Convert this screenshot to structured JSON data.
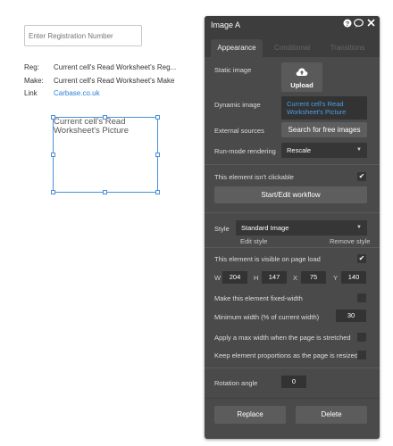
{
  "canvas": {
    "reg_placeholder": "Enter Registration Number",
    "rows": [
      {
        "key": "Reg:",
        "value": "Current cell's Read Worksheet's Reg..."
      },
      {
        "key": "Make:",
        "value": "Current cell's Read Worksheet's Make"
      },
      {
        "key": "Link",
        "value": "Carbase.co.uk"
      }
    ],
    "image_text": "Current cell's Read Worksheet's Picture"
  },
  "panel": {
    "title": "Image A",
    "tabs": [
      "Appearance",
      "Conditional",
      "Transitions"
    ],
    "static_image_label": "Static image",
    "upload_label": "Upload",
    "dynamic_image_label": "Dynamic image",
    "dynamic_image_value": "Current cell's Read Worksheet's Picture",
    "external_sources_label": "External sources",
    "search_free_images": "Search for free images",
    "run_mode_label": "Run-mode rendering",
    "run_mode_value": "Rescale",
    "not_clickable_label": "This element isn't clickable",
    "workflow_button": "Start/Edit workflow",
    "style_label": "Style",
    "style_value": "Standard Image",
    "edit_style": "Edit style",
    "remove_style": "Remove style",
    "visible_label": "This element is visible on page load",
    "w_label": "W",
    "w_value": "204",
    "h_label": "H",
    "h_value": "147",
    "x_label": "X",
    "x_value": "75",
    "y_label": "Y",
    "y_value": "140",
    "fixed_width_label": "Make this element fixed-width",
    "min_width_label": "Minimum width (% of current width)",
    "min_width_value": "30",
    "max_width_label": "Apply a max width when the page is stretched",
    "keep_props_label": "Keep element proportions as the page is resized",
    "rotation_label": "Rotation angle",
    "rotation_value": "0",
    "replace_button": "Replace",
    "delete_button": "Delete"
  }
}
